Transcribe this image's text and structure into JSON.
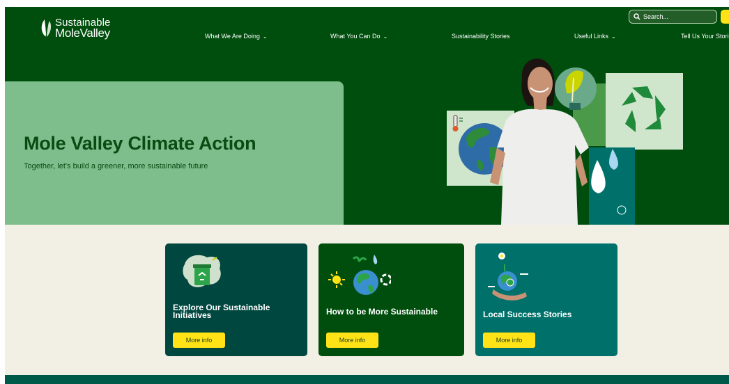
{
  "logo": {
    "line1": "Sustainable",
    "line2": "MoleValley"
  },
  "nav": {
    "items": [
      {
        "label": "What We Are Doing",
        "chevron": "⌄"
      },
      {
        "label": "What You Can Do",
        "chevron": "⌄"
      },
      {
        "label": "Sustainability Stories",
        "chevron": ""
      },
      {
        "label": "Useful Links",
        "chevron": "⌄"
      },
      {
        "label": "Tell Us Your Stories",
        "chevron": ""
      }
    ]
  },
  "search": {
    "placeholder": "Search...",
    "value": ""
  },
  "hero": {
    "title": "Mole Valley Climate Action",
    "subtitle": "Together, let's build a greener, more sustainable future"
  },
  "cards": [
    {
      "title": "Explore Our Sustainable Initiatives",
      "button": "More info"
    },
    {
      "title": "How to be More Sustainable",
      "button": "More info"
    },
    {
      "title": "Local Success Stories",
      "button": "More info"
    }
  ],
  "colors": {
    "primary_dark": "#004e0d",
    "hero_panel": "#7dbe8c",
    "accent_yellow": "#ffe316",
    "card_teal_dark": "#00473f",
    "card_green": "#004e0d",
    "card_teal": "#00716a",
    "lower_bg": "#f2f0e4"
  },
  "icons": [
    "leaf-logo-icon",
    "search-icon",
    "chevron-down-icon",
    "recycle-bin-icon",
    "globe-sun-recycle-icon",
    "globe-in-hand-icon",
    "thermometer-icon",
    "recycle-icon",
    "lightbulb-leaf-icon",
    "water-drops-icon"
  ]
}
